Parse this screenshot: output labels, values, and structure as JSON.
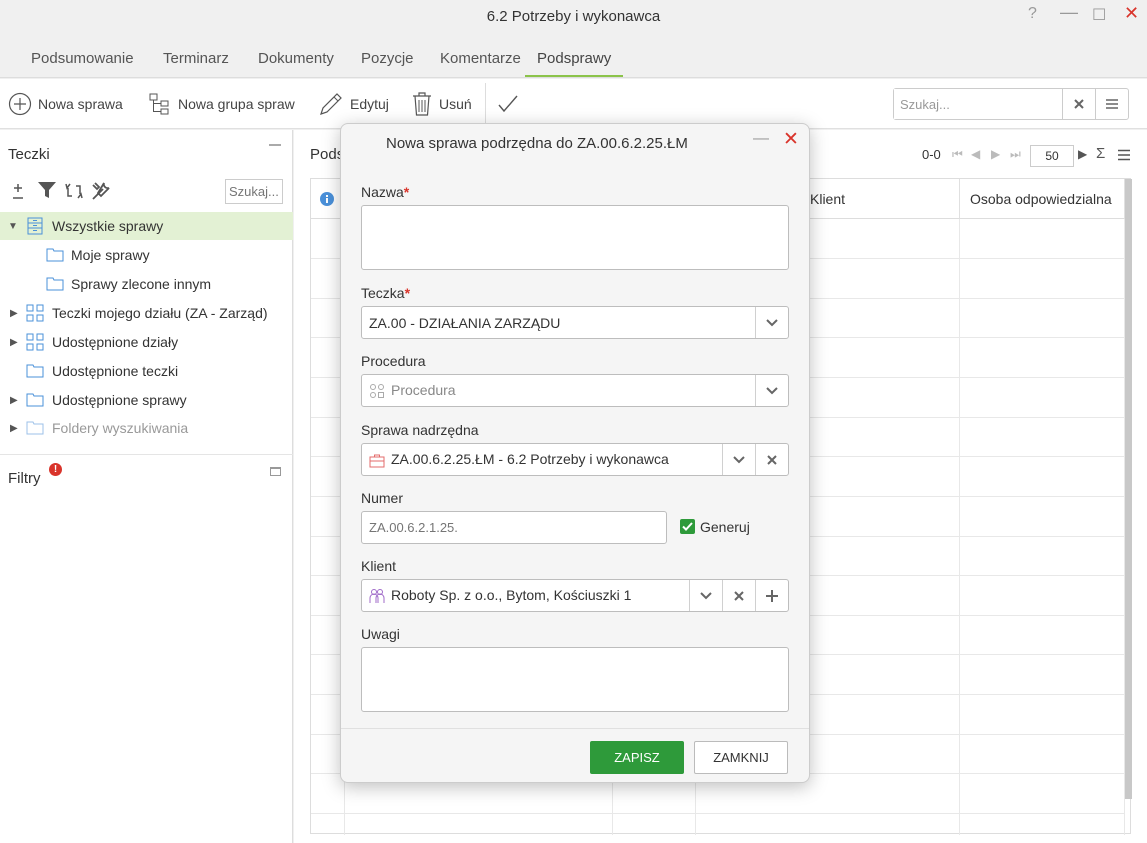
{
  "window": {
    "title": "6.2 Potrzeby i wykonawca",
    "help": "?",
    "minimize": "—",
    "maximize": "☐",
    "close": "✕"
  },
  "tabs": [
    {
      "label": "Podsumowanie"
    },
    {
      "label": "Terminarz"
    },
    {
      "label": "Dokumenty"
    },
    {
      "label": "Pozycje"
    },
    {
      "label": "Komentarze"
    },
    {
      "label": "Podsprawy",
      "active": true
    }
  ],
  "toolbar": {
    "new_case": "Nowa sprawa",
    "new_group": "Nowa grupa spraw",
    "edit": "Edytuj",
    "delete": "Usuń",
    "search_placeholder": "Szukaj..."
  },
  "left": {
    "title": "Teczki",
    "search_placeholder": "Szukaj...",
    "tree": [
      {
        "label": "Wszystkie sprawy",
        "selected": true
      },
      {
        "label": "Moje sprawy"
      },
      {
        "label": "Sprawy zlecone innym"
      },
      {
        "label": "Teczki mojego działu (ZA - Zarząd)"
      },
      {
        "label": "Udostępnione działy"
      },
      {
        "label": "Udostępnione teczki"
      },
      {
        "label": "Udostępnione sprawy"
      },
      {
        "label": "Foldery wyszukiwania",
        "dim": true
      }
    ],
    "filters_title": "Filtry",
    "filters_badge": "!"
  },
  "main": {
    "title": "Pods",
    "pager_count": "0-0",
    "page_size": "50",
    "columns": [
      "Klient",
      "Osoba odpowiedzialna"
    ]
  },
  "modal": {
    "title": "Nowa sprawa podrzędna do ZA.00.6.2.25.ŁM",
    "name_label": "Nazwa",
    "required_mark": "*",
    "folder_label": "Teczka",
    "folder_value": "ZA.00 - DZIAŁANIA ZARZĄDU",
    "procedure_label": "Procedura",
    "procedure_placeholder": "Procedura",
    "parent_label": "Sprawa nadrzędna",
    "parent_value": "ZA.00.6.2.25.ŁM - 6.2 Potrzeby i wykonawca",
    "number_label": "Numer",
    "number_placeholder": "ZA.00.6.2.1.25.",
    "generate_label": "Generuj",
    "generate_checked": true,
    "client_label": "Klient",
    "client_value": "Roboty Sp. z o.o., Bytom, Kościuszki 1",
    "notes_label": "Uwagi",
    "save_label": "ZAPISZ",
    "close_label": "ZAMKNIJ"
  },
  "colors": {
    "accent": "#8bc34a",
    "primary_button": "#2e9a3a",
    "danger": "#d9342b",
    "selected_row": "#e3f1d4",
    "icon_blue": "#4a90d9"
  }
}
